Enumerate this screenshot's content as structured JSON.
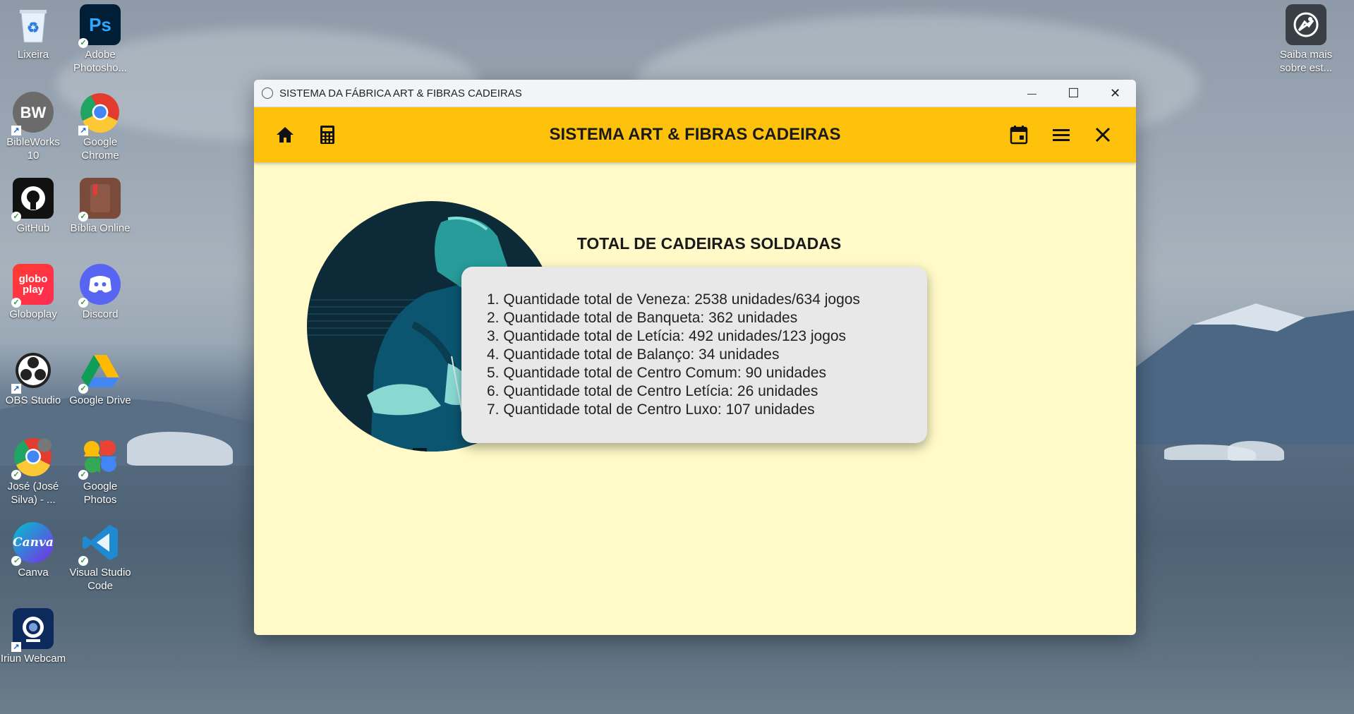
{
  "desktop": {
    "icons": [
      {
        "name": "recycle-bin-icon",
        "label": "Lixeira"
      },
      {
        "name": "photoshop-icon",
        "label": "Adobe Photosho...",
        "tile_text": "Ps"
      },
      {
        "name": "bibleworks-icon",
        "label": "BibleWorks 10",
        "tile_text": "BW"
      },
      {
        "name": "chrome-icon",
        "label": "Google Chrome"
      },
      {
        "name": "github-icon",
        "label": "GitHub"
      },
      {
        "name": "biblia-online-icon",
        "label": "Bíblia Online"
      },
      {
        "name": "globoplay-icon",
        "label": "Globoplay",
        "tile_text": "globo play"
      },
      {
        "name": "discord-icon",
        "label": "Discord"
      },
      {
        "name": "obs-studio-icon",
        "label": "OBS Studio"
      },
      {
        "name": "google-drive-icon",
        "label": "Google Drive"
      },
      {
        "name": "chrome-profile-icon",
        "label": "José (José Silva) - ..."
      },
      {
        "name": "google-photos-icon",
        "label": "Google Photos"
      },
      {
        "name": "canva-icon",
        "label": "Canva",
        "tile_text": "Canva"
      },
      {
        "name": "vscode-icon",
        "label": "Visual Studio Code"
      },
      {
        "name": "iriun-webcam-icon",
        "label": "Iriun Webcam"
      },
      {
        "name": "saiba-mais-icon",
        "label": "Saiba mais sobre est..."
      }
    ]
  },
  "window": {
    "title": "SISTEMA DA FÁBRICA ART & FIBRAS CADEIRAS",
    "controls": {
      "minimize": "—",
      "maximize": "☐",
      "close": "✕"
    }
  },
  "appbar": {
    "heading": "SISTEMA ART & FIBRAS CADEIRAS",
    "icons": [
      "home-icon",
      "calculator-icon",
      "calendar-icon",
      "menu-icon",
      "close-icon"
    ]
  },
  "main": {
    "section_title": "TOTAL DE CADEIRAS SOLDADAS",
    "items": [
      "1. Quantidade total de Veneza: 2538 unidades/634 jogos",
      "2. Quantidade total de Banqueta: 362 unidades",
      "3. Quantidade total de Letícia: 492 unidades/123 jogos",
      "4. Quantidade total de Balanço: 34 unidades",
      "5. Quantidade total de Centro Comum: 90 unidades",
      "6. Quantidade total de Centro Letícia: 26 unidades",
      "7. Quantidade total de Centro Luxo: 107 unidades"
    ]
  },
  "colors": {
    "appbar": "#fec20c",
    "window_background": "#fffac8",
    "card_background": "#e8e8e8"
  }
}
